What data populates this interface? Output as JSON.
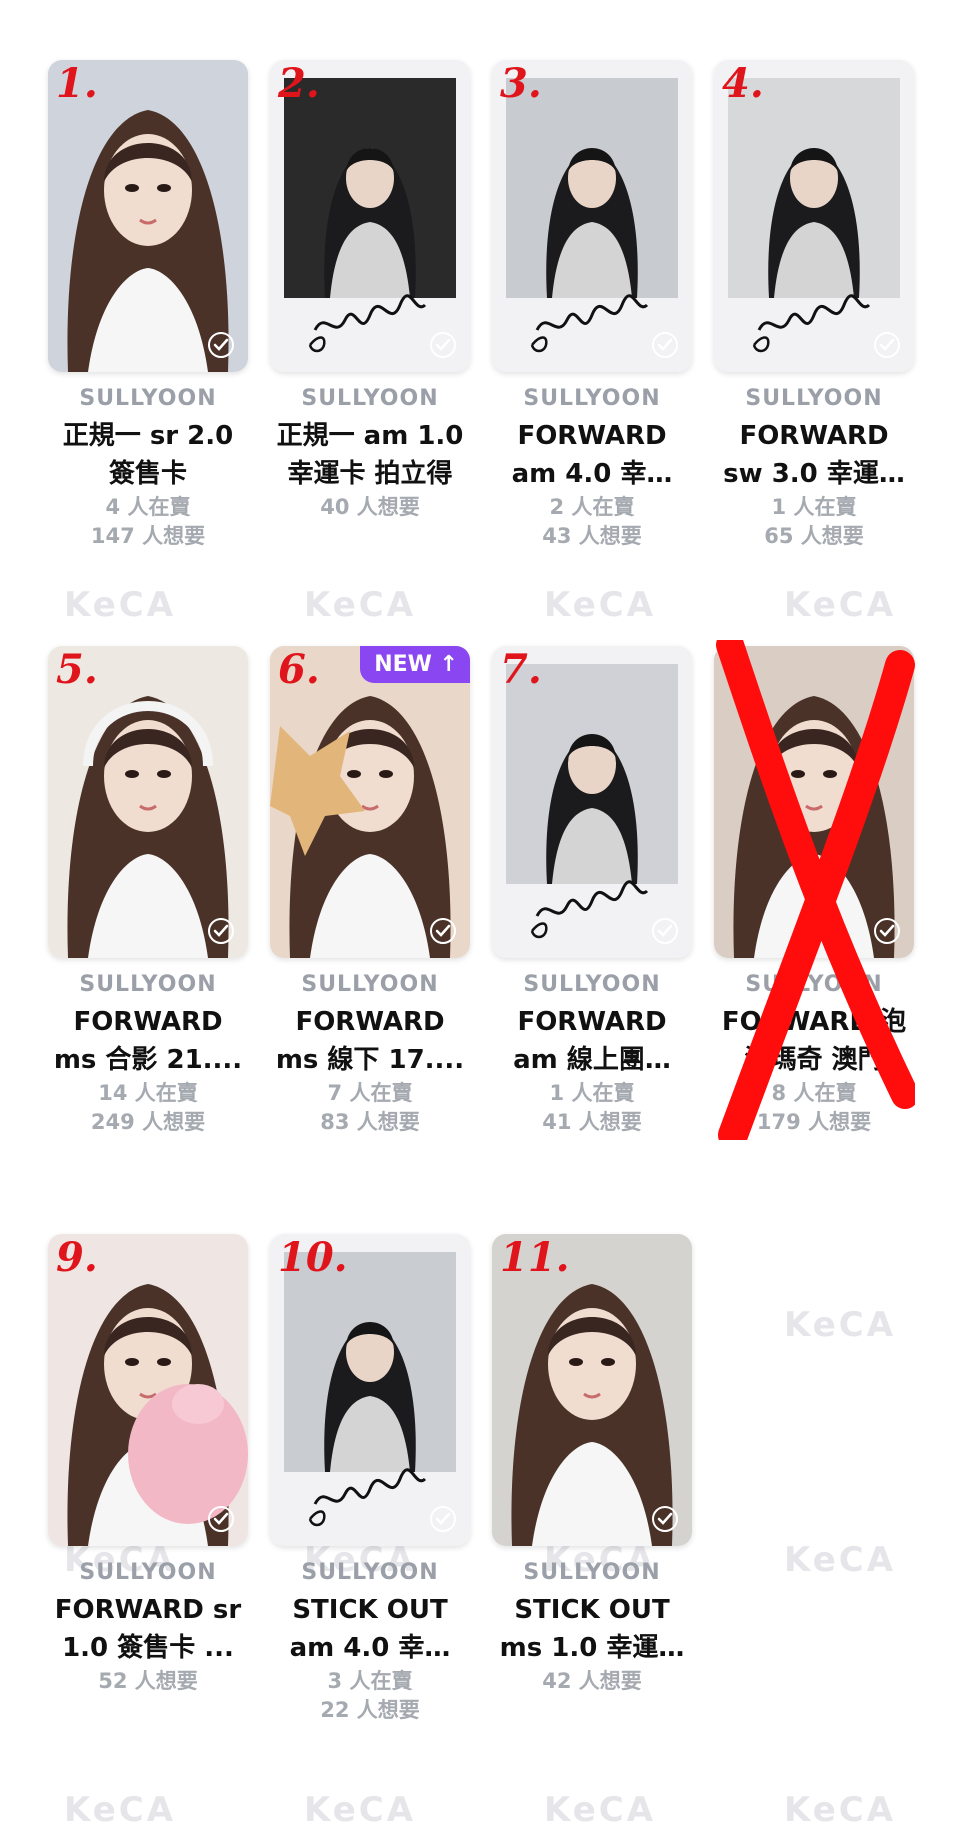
{
  "watermark_text": "KeCA",
  "cards": [
    {
      "number": "1.",
      "artist": "SULLYOON",
      "title_line1": "正規一 sr 2.0",
      "title_line2": "簽售卡",
      "selling": "4 人在賣",
      "wanting": "147 人想要",
      "photo": "dark-hair-portrait",
      "bg": "#cfd3dc",
      "frame": false
    },
    {
      "number": "2.",
      "artist": "SULLYOON",
      "title_line1": "正規一 am 1.0",
      "title_line2": "幸運卡 拍立得",
      "selling": "",
      "wanting": "40 人想要",
      "photo": "polaroid-black-white",
      "bg": "#2a2a2a",
      "frame": true
    },
    {
      "number": "3.",
      "artist": "SULLYOON",
      "title_line1": "FORWARD",
      "title_line2": "am 4.0 幸…",
      "selling": "2 人在賣",
      "wanting": "43 人想要",
      "photo": "polaroid-peace-sign",
      "bg": "#c8cbd0",
      "frame": true
    },
    {
      "number": "4.",
      "artist": "SULLYOON",
      "title_line1": "FORWARD",
      "title_line2": "sw 3.0 幸運…",
      "selling": "1 人在賣",
      "wanting": "65 人想要",
      "photo": "polaroid-white-jacket",
      "bg": "#d6d8da",
      "frame": true
    },
    {
      "number": "5.",
      "artist": "SULLYOON",
      "title_line1": "FORWARD",
      "title_line2": "ms 合影 21....",
      "selling": "14 人在賣",
      "wanting": "249 人想要",
      "photo": "headphones-wink",
      "bg": "#eee8e3",
      "frame": false
    },
    {
      "number": "6.",
      "artist": "SULLYOON",
      "title_line1": "FORWARD",
      "title_line2": "ms 線下 17....",
      "selling": "7 人在賣",
      "wanting": "83 人想要",
      "photo": "star-bread",
      "bg": "#e9d7c9",
      "frame": false,
      "badge": "NEW ↑"
    },
    {
      "number": "7.",
      "artist": "SULLYOON",
      "title_line1": "FORWARD",
      "title_line2": "am 線上團…",
      "selling": "1 人在賣",
      "wanting": "41 人想要",
      "photo": "polaroid-hand-cheek",
      "bg": "#cfd1d6",
      "frame": true
    },
    {
      "number": "",
      "artist": "SULLYOON",
      "title_line1": "FORWARD 泡",
      "title_line2": "泡瑪奇 澳門",
      "selling": "8 人在賣",
      "wanting": "179 人想要",
      "photo": "bangs-portrait",
      "bg": "#d9cdc4",
      "frame": false
    },
    {
      "number": "9.",
      "artist": "SULLYOON",
      "title_line1": "FORWARD sr",
      "title_line2": "1.0 簽售卡 ...",
      "selling": "",
      "wanting": "52 人想要",
      "photo": "pink-plush",
      "bg": "#efe6e4",
      "frame": false
    },
    {
      "number": "10.",
      "artist": "SULLYOON",
      "title_line1": "STICK OUT",
      "title_line2": "am 4.0 幸…",
      "selling": "3 人在賣",
      "wanting": "22 人想要",
      "photo": "polaroid-headset",
      "bg": "#c9ccd1",
      "frame": true
    },
    {
      "number": "11.",
      "artist": "SULLYOON",
      "title_line1": "STICK OUT",
      "title_line2": "ms 1.0 幸運…",
      "selling": "",
      "wanting": "42 人想要",
      "photo": "half-up-portrait",
      "bg": "#d5d3d0",
      "frame": false
    }
  ]
}
